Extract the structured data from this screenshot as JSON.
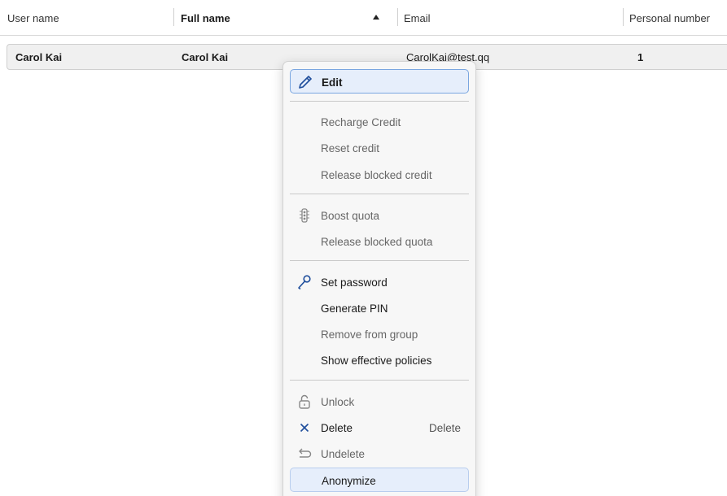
{
  "table": {
    "columns": [
      {
        "label": "User name",
        "sorted": false
      },
      {
        "label": "Full name",
        "sorted": true,
        "sort_direction": "ascending"
      },
      {
        "label": "Email",
        "sorted": false
      },
      {
        "label": "Personal number",
        "sorted": false
      }
    ],
    "rows": [
      {
        "user_name": "Carol Kai",
        "full_name": "Carol Kai",
        "email": "CarolKai@test.qq",
        "personal_number": "1"
      }
    ]
  },
  "context_menu": {
    "edit": "Edit",
    "recharge_credit": "Recharge Credit",
    "reset_credit": "Reset credit",
    "release_blocked_credit": "Release blocked credit",
    "boost_quota": "Boost quota",
    "release_blocked_quota": "Release blocked quota",
    "set_password": "Set password",
    "generate_pin": "Generate PIN",
    "remove_from_group": "Remove from group",
    "show_effective_policies": "Show effective policies",
    "unlock": "Unlock",
    "delete": "Delete",
    "delete_shortcut": "Delete",
    "undelete": "Undelete",
    "anonymize": "Anonymize"
  },
  "icons": {
    "edit": "pencil-icon",
    "boost_quota": "traffic-light-icon",
    "set_password": "key-icon",
    "unlock": "unlock-icon",
    "delete": "close-icon",
    "undelete": "undo-icon"
  },
  "colors": {
    "selected_row_bg": "#f0f0f0",
    "focus_border": "#7aa6e0",
    "highlight_bg": "#e6eefb"
  }
}
